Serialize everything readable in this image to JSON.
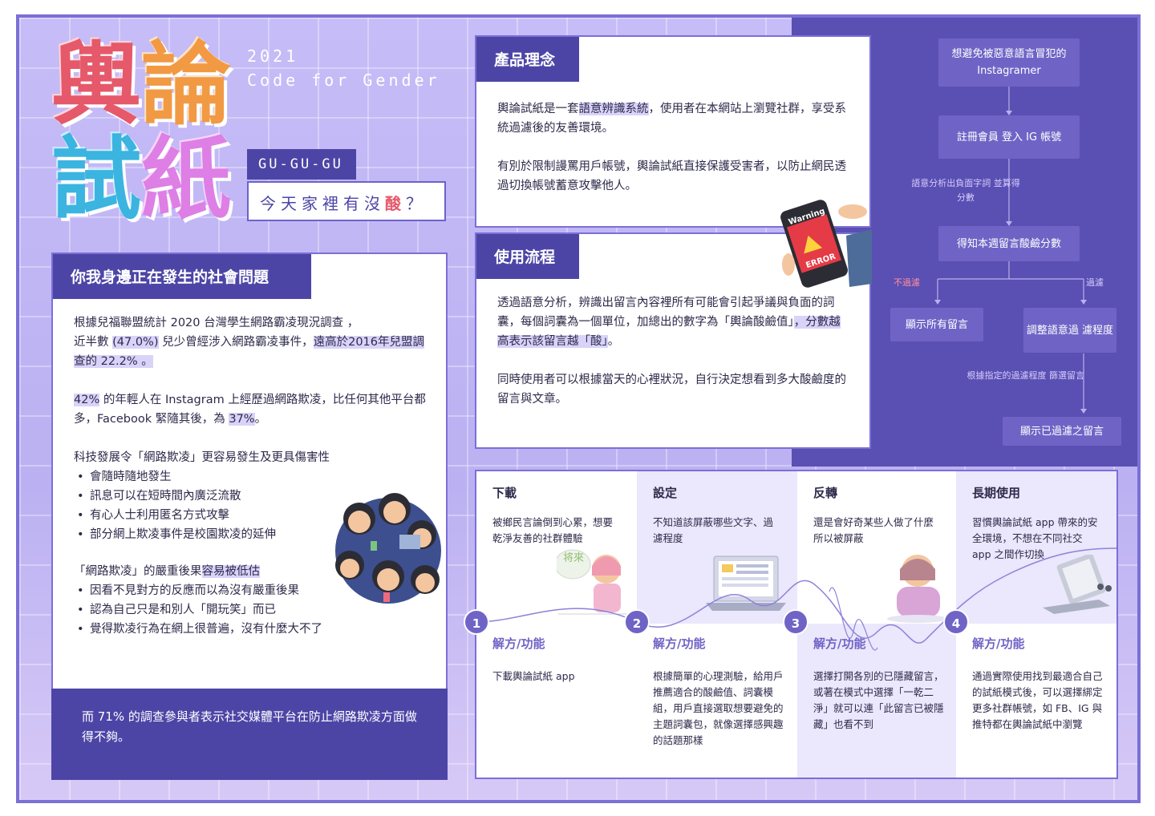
{
  "header": {
    "title_chars": [
      "輿",
      "論",
      "試",
      "紙"
    ],
    "year": "2021",
    "event": "Code for Gender",
    "team": "GU-GU-GU",
    "tagline_pre": "今天家裡有沒",
    "tagline_sour": "酸",
    "tagline_post": "？"
  },
  "problem": {
    "heading": "你我身邊正在發生的社會問題",
    "p1_a": "根據兒福聯盟統計 2020 台灣學生網路霸凌現況調查 ，",
    "p1_b": "近半數",
    "p1_c": "(47.0%)",
    "p1_d": " 兒少曾經涉入網路霸凌事件，",
    "p1_e": "遠高於2016年兒盟調查的 22.2% 。",
    "p2_a": "42%",
    "p2_b": " 的年輕人在 Instagram 上經歷過網路欺凌，比任何其他平台都多，Facebook 緊隨其後，為 ",
    "p2_c": "37%",
    "p2_d": "。",
    "p3_title": "科技發展令「網路欺凌」更容易發生及更具傷害性",
    "p3_items": [
      "會隨時隨地發生",
      "訊息可以在短時間內廣泛流散",
      "有心人士利用匿名方式攻擊",
      "部分網上欺凌事件是校園欺凌的延伸"
    ],
    "p4_title_a": "「網路欺凌」的嚴重後果",
    "p4_title_b": "容易被低估",
    "p4_items": [
      "因看不見對方的反應而以為沒有嚴重後果",
      "認為自己只是和別人「開玩笑」而已",
      "覺得欺凌行為在網上很普遍，沒有什麼大不了"
    ],
    "footer": "而 71% 的調查參與者表示社交媒體平台在防止網路欺凌方面做得不夠。"
  },
  "concept": {
    "heading": "產品理念",
    "p1_a": "輿論試紙是一套",
    "p1_b": "語意辨識系統",
    "p1_c": "，使用者在本網站上瀏覽社群，享受系統過濾後的友善環境。",
    "p2": "有別於限制謾罵用戶帳號，輿論試紙直接保護受害者，以防止網民透過切換帳號蓄意攻擊他人。"
  },
  "flow": {
    "heading": "使用流程",
    "p1_a": "透過語意分析，辨識出留言內容裡所有可能會引起爭議與負面的詞囊，每個詞囊為一個單位，加總出的數字為「輿論酸鹼值」",
    "p1_b": "，分數越高表示該留言越「酸」",
    "p1_c": "。",
    "p2": "同時使用者可以根據當天的心裡狀況，自行決定想看到多大酸鹼度的留言與文章。",
    "warning_label": "Warning",
    "error_label": "ERROR"
  },
  "flowchart": {
    "box1": "想避免被惡意語言冒犯的 Instagramer",
    "box2": "註冊會員 登入 IG 帳號",
    "note1": "語意分析出負面字詞 並算得分數",
    "box3": "得知本週留言酸鹼分數",
    "label_nofilter": "不過濾",
    "label_filter": "過濾",
    "box4": "顯示所有留言",
    "box5": "調整語意過 濾程度",
    "note2": "根據指定的過濾程度 篩選留言",
    "box6": "顯示已過濾之留言"
  },
  "steps": [
    {
      "num": "1",
      "title": "下載",
      "desc": "被鄉民言論倒到心累，想要乾淨友善的社群體驗",
      "sol_title": "解方/功能",
      "sol_desc": "下載輿論試紙 app",
      "art_text": "将來"
    },
    {
      "num": "2",
      "title": "設定",
      "desc": "不知道該屏蔽哪些文字、過濾程度",
      "sol_title": "解方/功能",
      "sol_desc": "根據簡單的心理測驗，給用戶推薦適合的酸鹼值、詞囊模組，用戶直接選取想要避免的主題詞囊包，就像選擇感興趣的話題那樣"
    },
    {
      "num": "3",
      "title": "反轉",
      "desc": "還是會好奇某些人做了什麼所以被屏蔽",
      "sol_title": "解方/功能",
      "sol_desc": "選擇打開各別的已隱藏留言，或著在模式中選擇「一乾二淨」就可以連「此留言已被隱藏」也看不到"
    },
    {
      "num": "4",
      "title": "長期使用",
      "desc": "習慣輿論試紙 app 帶來的安全環境，不想在不同社交 app 之間作切換",
      "sol_title": "解方/功能",
      "sol_desc": "通過實際使用找到最適合自己的試紙模式後，可以選擇綁定更多社群帳號，如 FB、IG 與推特都在輿論試紙中瀏覽"
    }
  ],
  "colors": {
    "accent": "#4d45a6",
    "panel": "#5a4fb2",
    "highlight": "#d9d3fa",
    "title_red": "#e5596a",
    "title_orange": "#f19a43",
    "title_blue": "#3bb4e0",
    "title_pink": "#dd7fe5"
  }
}
